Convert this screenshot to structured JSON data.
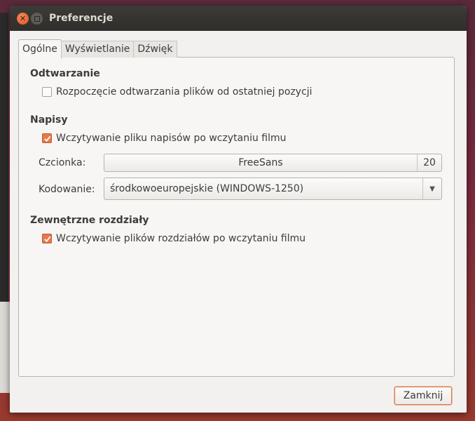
{
  "window": {
    "title": "Preferencje"
  },
  "tabs": [
    {
      "label": "Ogólne",
      "active": true
    },
    {
      "label": "Wyświetlanie",
      "active": false
    },
    {
      "label": "Dźwięk",
      "active": false
    }
  ],
  "general": {
    "playback": {
      "title": "Odtwarzanie",
      "resume_label": "Rozpoczęcie odtwarzania plików od ostatniej pozycji",
      "resume_checked": false
    },
    "subtitles": {
      "title": "Napisy",
      "autoload_label": "Wczytywanie pliku napisów po wczytaniu filmu",
      "autoload_checked": true,
      "font_label": "Czcionka:",
      "font_name": "FreeSans",
      "font_size": "20",
      "encoding_label": "Kodowanie:",
      "encoding_value": "środkowoeuropejskie (WINDOWS-1250)"
    },
    "chapters": {
      "title": "Zewnętrzne rozdziały",
      "autoload_label": "Wczytywanie plików rozdziałów po wczytaniu filmu",
      "autoload_checked": true
    }
  },
  "footer": {
    "close_label": "Zamknij"
  },
  "colors": {
    "accent": "#e6784c",
    "titlebar": "#3c3b37",
    "window_bg": "#f2f1f0"
  },
  "icons": {
    "close": "close-icon",
    "minimize": "minimize-icon",
    "check": "checkmark-icon",
    "dropdown": "chevron-down-icon"
  }
}
